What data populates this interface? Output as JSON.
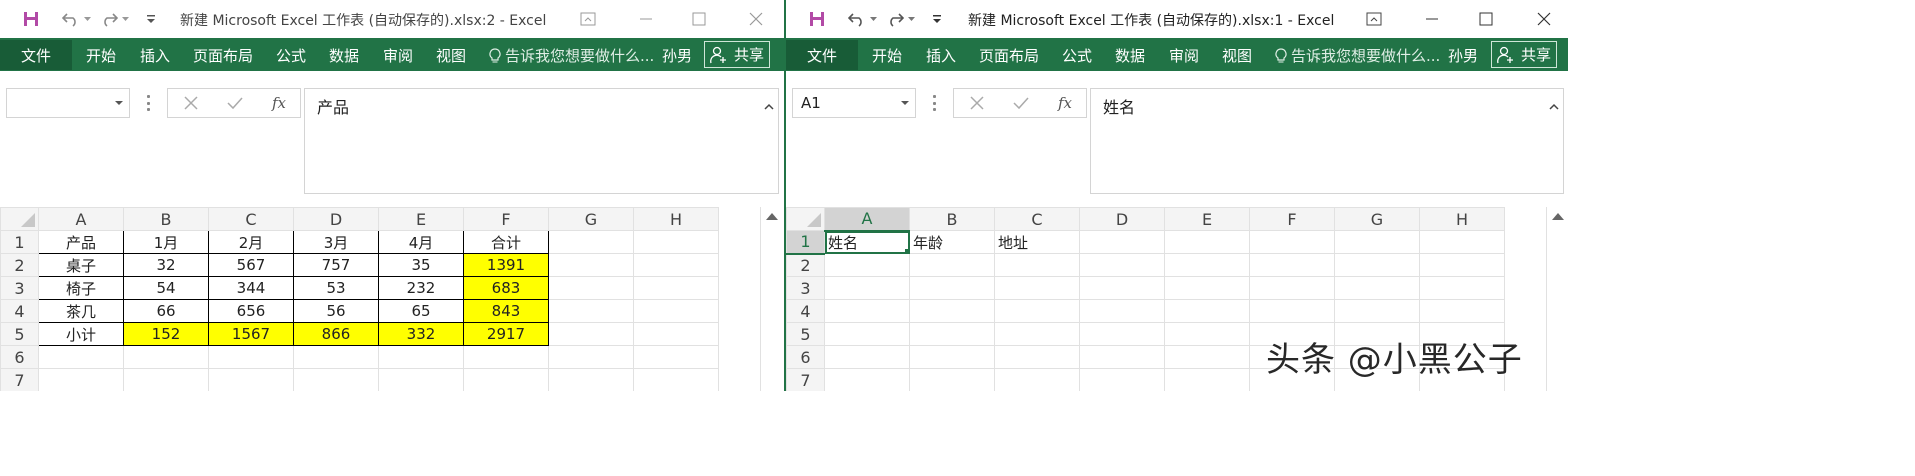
{
  "left_window": {
    "title": "新建 Microsoft Excel 工作表 (自动保存的).xlsx:2 - Excel",
    "ribbon": {
      "file": "文件",
      "tabs": [
        "开始",
        "插入",
        "页面布局",
        "公式",
        "数据",
        "审阅",
        "视图"
      ],
      "tell_me": "告诉我您想要做什么...",
      "user": "孙男",
      "share": "共享"
    },
    "name_box": "",
    "formula_icons": {
      "cancel": "✕",
      "enter": "✓",
      "fx": "fx"
    },
    "formula_value": "产品",
    "columns": [
      "A",
      "B",
      "C",
      "D",
      "E",
      "F",
      "G",
      "H"
    ],
    "rows": [
      {
        "num": "1",
        "cells": [
          "产品",
          "1月",
          "2月",
          "3月",
          "4月",
          "合计",
          "",
          ""
        ]
      },
      {
        "num": "2",
        "cells": [
          "桌子",
          "32",
          "567",
          "757",
          "35",
          "1391",
          "",
          ""
        ]
      },
      {
        "num": "3",
        "cells": [
          "椅子",
          "54",
          "344",
          "53",
          "232",
          "683",
          "",
          ""
        ]
      },
      {
        "num": "4",
        "cells": [
          "茶几",
          "66",
          "656",
          "56",
          "65",
          "843",
          "",
          ""
        ]
      },
      {
        "num": "5",
        "cells": [
          "小计",
          "152",
          "1567",
          "866",
          "332",
          "2917",
          "",
          ""
        ]
      },
      {
        "num": "6",
        "cells": [
          "",
          "",
          "",
          "",
          "",
          "",
          "",
          ""
        ]
      },
      {
        "num": "7",
        "cells": [
          "",
          "",
          "",
          "",
          "",
          "",
          "",
          ""
        ]
      }
    ],
    "highlight_color": "#ffff00"
  },
  "right_window": {
    "title": "新建 Microsoft Excel 工作表 (自动保存的).xlsx:1 - Excel",
    "ribbon": {
      "file": "文件",
      "tabs": [
        "开始",
        "插入",
        "页面布局",
        "公式",
        "数据",
        "审阅",
        "视图"
      ],
      "tell_me": "告诉我您想要做什么...",
      "user": "孙男",
      "share": "共享"
    },
    "name_box": "A1",
    "formula_icons": {
      "cancel": "✕",
      "enter": "✓",
      "fx": "fx"
    },
    "formula_value": "姓名",
    "columns": [
      "A",
      "B",
      "C",
      "D",
      "E",
      "F",
      "G",
      "H"
    ],
    "rows": [
      {
        "num": "1",
        "cells": [
          "姓名",
          "年龄",
          "地址",
          "",
          "",
          "",
          "",
          ""
        ]
      },
      {
        "num": "2",
        "cells": [
          "",
          "",
          "",
          "",
          "",
          "",
          "",
          ""
        ]
      },
      {
        "num": "3",
        "cells": [
          "",
          "",
          "",
          "",
          "",
          "",
          "",
          ""
        ]
      },
      {
        "num": "4",
        "cells": [
          "",
          "",
          "",
          "",
          "",
          "",
          "",
          ""
        ]
      },
      {
        "num": "5",
        "cells": [
          "",
          "",
          "",
          "",
          "",
          "",
          "",
          ""
        ]
      },
      {
        "num": "6",
        "cells": [
          "",
          "",
          "",
          "",
          "",
          "",
          "",
          ""
        ]
      },
      {
        "num": "7",
        "cells": [
          "",
          "",
          "",
          "",
          "",
          "",
          "",
          ""
        ]
      }
    ],
    "active_cell": "A1"
  },
  "watermark": "头条 @小黑公子",
  "colors": {
    "excel_green": "#217346",
    "file_tab": "#185c37",
    "gridline": "#e1e1e1"
  }
}
